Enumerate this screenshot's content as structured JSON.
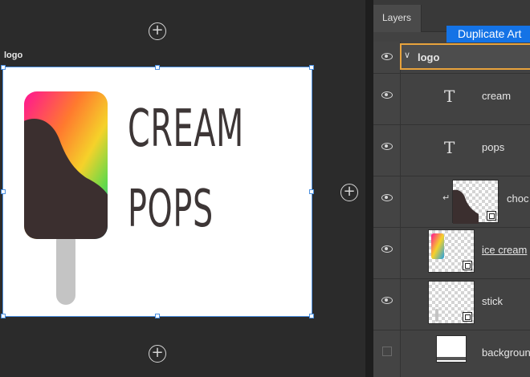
{
  "artboard": {
    "name": "logo",
    "brand_line1": "CREAM",
    "brand_line2": "POPS"
  },
  "canvas": {
    "add_icon": "plus-circle-icon"
  },
  "panel": {
    "tab_label": "Layers",
    "duplicate_button": "Duplicate Art"
  },
  "layers": [
    {
      "name": "logo",
      "kind": "group",
      "visible": true,
      "selected": true
    },
    {
      "name": "cream",
      "kind": "text",
      "visible": true
    },
    {
      "name": "pops",
      "kind": "text",
      "visible": true
    },
    {
      "name": "choc",
      "kind": "image",
      "visible": true,
      "clipped": true
    },
    {
      "name": "ice cream",
      "kind": "image",
      "visible": true
    },
    {
      "name": "stick",
      "kind": "image",
      "visible": true
    },
    {
      "name": "backgroun",
      "kind": "image",
      "visible": false
    }
  ],
  "colors": {
    "selection": "#4a8fe0",
    "group_highlight": "#e8a33c",
    "button_blue": "#1473e6",
    "chocolate": "#3b2f2f",
    "stick": "#c4c4c4"
  }
}
